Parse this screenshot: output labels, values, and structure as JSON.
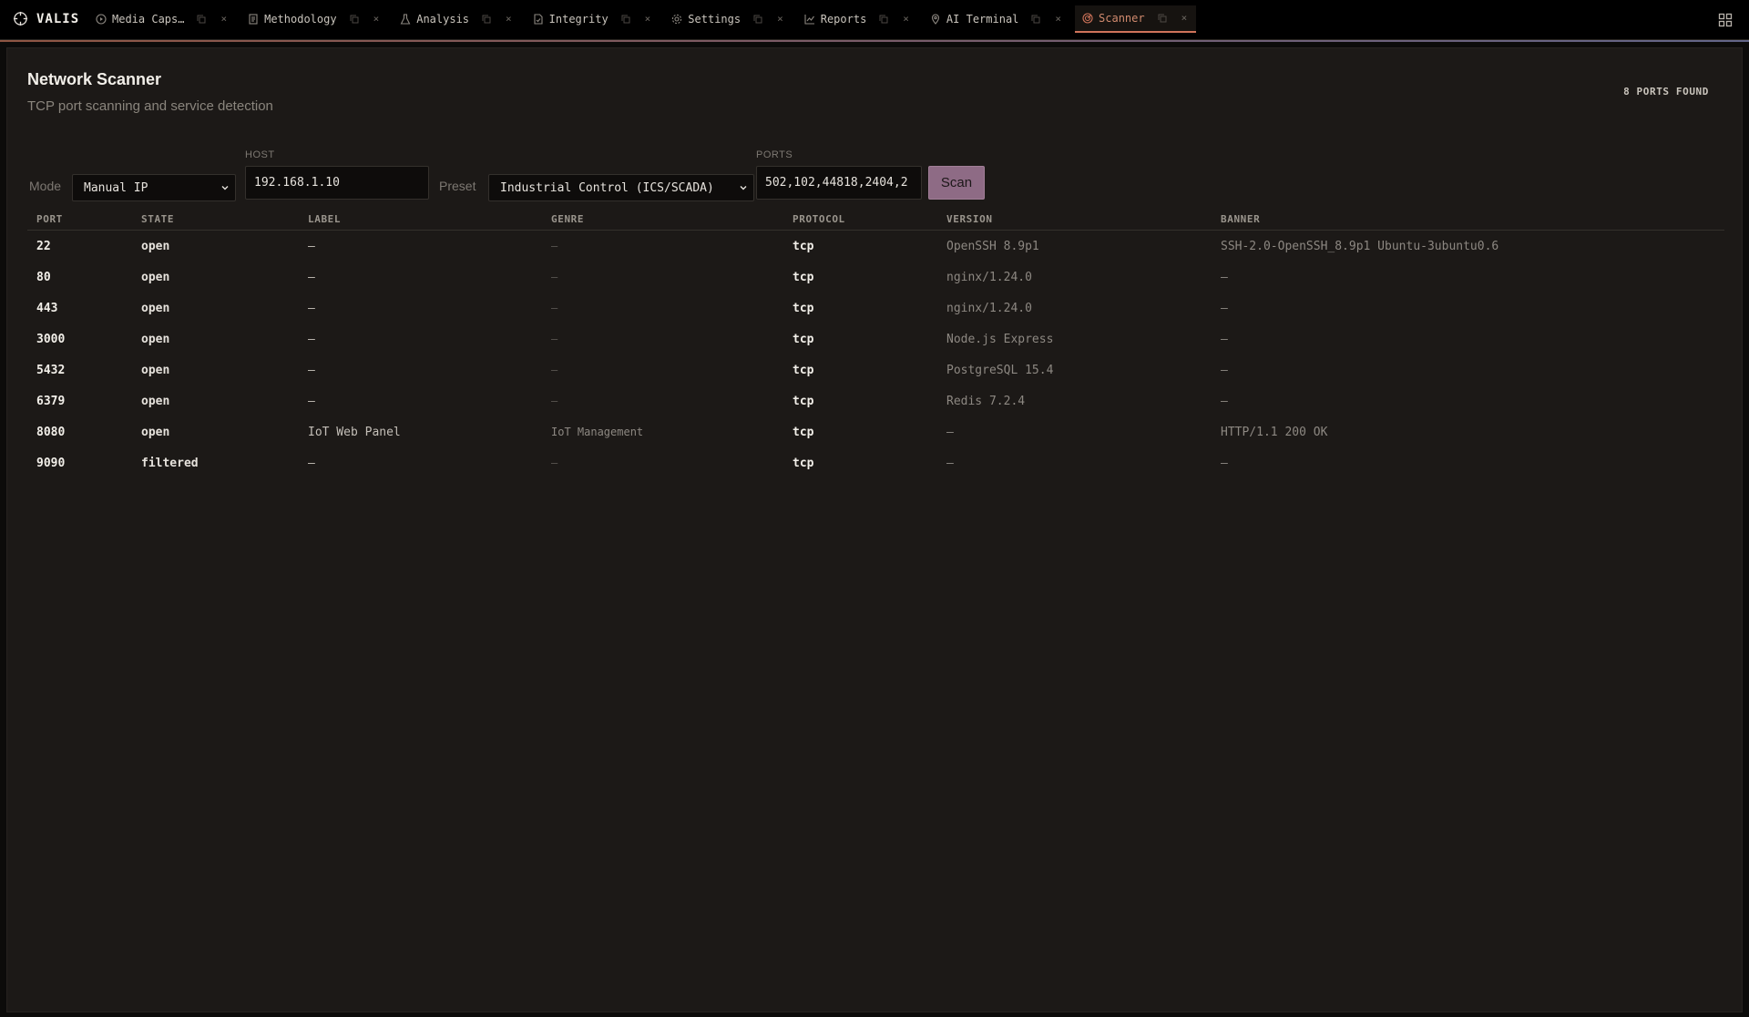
{
  "app": {
    "name": "VALIS"
  },
  "tabs": [
    {
      "label": "Media Caps…",
      "icon": "play-circle-icon",
      "active": false
    },
    {
      "label": "Methodology",
      "icon": "document-icon",
      "active": false
    },
    {
      "label": "Analysis",
      "icon": "flask-icon",
      "active": false
    },
    {
      "label": "Integrity",
      "icon": "file-check-icon",
      "active": false
    },
    {
      "label": "Settings",
      "icon": "gear-icon",
      "active": false
    },
    {
      "label": "Reports",
      "icon": "line-chart-icon",
      "active": false
    },
    {
      "label": "AI Terminal",
      "icon": "pin-icon",
      "active": false
    },
    {
      "label": "Scanner",
      "icon": "radar-icon",
      "active": true
    }
  ],
  "tab_close_glyph": "×",
  "page": {
    "title": "Network Scanner",
    "subtitle": "TCP port scanning and service detection",
    "ports_found": "8 PORTS FOUND"
  },
  "controls": {
    "mode_label": "Mode",
    "mode_value": "Manual IP",
    "host_caption": "HOST",
    "host_value": "192.168.1.10",
    "preset_label": "Preset",
    "preset_value": "Industrial Control (ICS/SCADA)",
    "ports_caption": "PORTS",
    "ports_value": "502,102,44818,2404,2",
    "scan_label": "Scan"
  },
  "table": {
    "headers": {
      "port": "PORT",
      "state": "STATE",
      "label": "LABEL",
      "genre": "GENRE",
      "protocol": "PROTOCOL",
      "version": "VERSION",
      "banner": "BANNER"
    },
    "rows": [
      {
        "port": "22",
        "state": "open",
        "label": "—",
        "genre": "—",
        "protocol": "tcp",
        "version": "OpenSSH 8.9p1",
        "banner": "SSH-2.0-OpenSSH_8.9p1 Ubuntu-3ubuntu0.6"
      },
      {
        "port": "80",
        "state": "open",
        "label": "—",
        "genre": "—",
        "protocol": "tcp",
        "version": "nginx/1.24.0",
        "banner": "—"
      },
      {
        "port": "443",
        "state": "open",
        "label": "—",
        "genre": "—",
        "protocol": "tcp",
        "version": "nginx/1.24.0",
        "banner": "—"
      },
      {
        "port": "3000",
        "state": "open",
        "label": "—",
        "genre": "—",
        "protocol": "tcp",
        "version": "Node.js Express",
        "banner": "—"
      },
      {
        "port": "5432",
        "state": "open",
        "label": "—",
        "genre": "—",
        "protocol": "tcp",
        "version": "PostgreSQL 15.4",
        "banner": "—"
      },
      {
        "port": "6379",
        "state": "open",
        "label": "—",
        "genre": "—",
        "protocol": "tcp",
        "version": "Redis 7.2.4",
        "banner": "—"
      },
      {
        "port": "8080",
        "state": "open",
        "label": "IoT Web Panel",
        "genre": "IoT Management",
        "protocol": "tcp",
        "version": "—",
        "banner": "HTTP/1.1 200 OK"
      },
      {
        "port": "9090",
        "state": "filtered",
        "label": "—",
        "genre": "—",
        "protocol": "tcp",
        "version": "—",
        "banner": "—"
      }
    ]
  },
  "colors": {
    "accent": "#d0745a",
    "scan_button": "#8e6b85",
    "panel_bg": "#1c1917",
    "topbar_bg": "#000000"
  }
}
